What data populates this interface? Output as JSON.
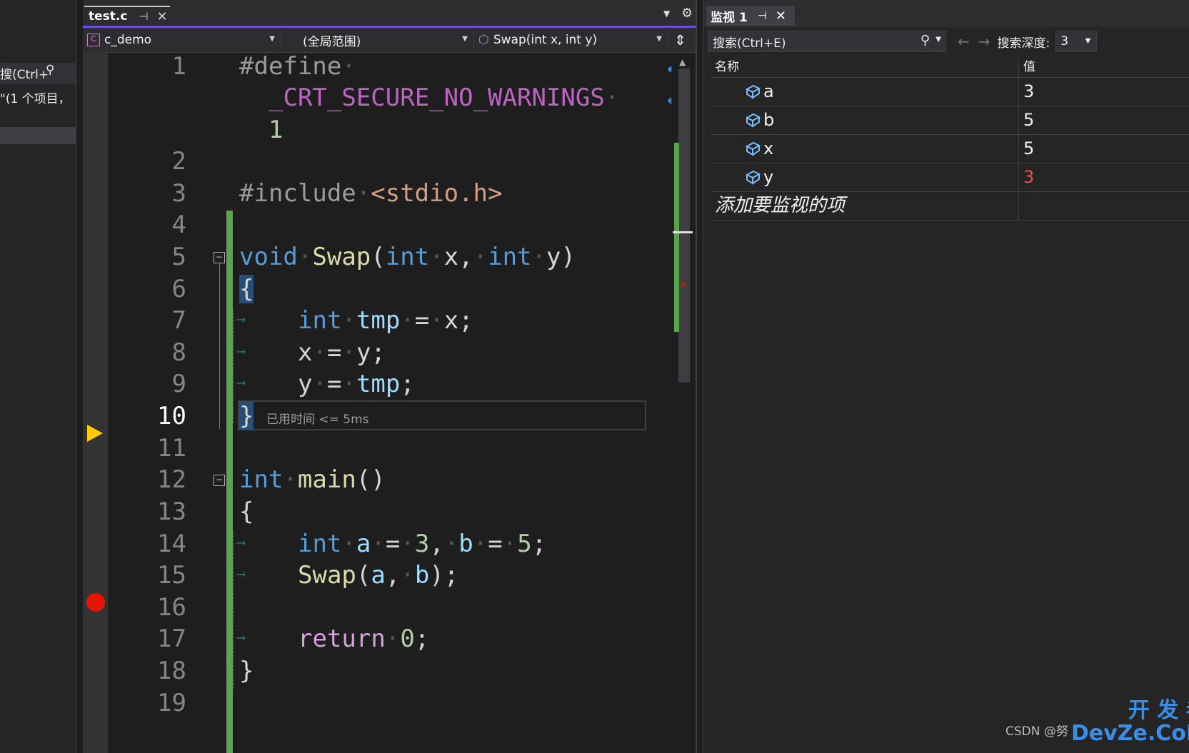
{
  "left_panel": {
    "search_fragment": "搜(Ctrl+",
    "result_fragment": "\"(1 个项目，"
  },
  "editor": {
    "tab": {
      "title": "test.c"
    },
    "nav": {
      "project": "c_demo",
      "scope": "(全局范围)",
      "member": "Swap(int x, int y)"
    },
    "line_numbers": [
      "1",
      "2",
      "3",
      "4",
      "5",
      "6",
      "7",
      "8",
      "9",
      "10",
      "11",
      "12",
      "13",
      "14",
      "15",
      "16",
      "17",
      "18",
      "19"
    ],
    "current_line": "10",
    "elapsed_hint": "已用时间 <= 5ms"
  },
  "watch": {
    "title": "监视 1",
    "search_placeholder": "搜索(Ctrl+E)",
    "depth_label": "搜索深度:",
    "depth_value": "3",
    "columns": {
      "name": "名称",
      "value": "值"
    },
    "rows": [
      {
        "name": "a",
        "value": "3"
      },
      {
        "name": "b",
        "value": "5"
      },
      {
        "name": "x",
        "value": "5"
      },
      {
        "name": "y",
        "value": "3"
      }
    ],
    "add_item": "添加要监视的项"
  },
  "watermark": "CSDN @努",
  "brand": {
    "line1": "开 发 者",
    "line2": "DevZe.CoM"
  },
  "colors": {
    "accent": "#6f4fe3",
    "changed_value": "#f14c4c",
    "breakpoint": "#e51400",
    "current_arrow": "#ffcc00",
    "change_bar": "#57a64a"
  }
}
